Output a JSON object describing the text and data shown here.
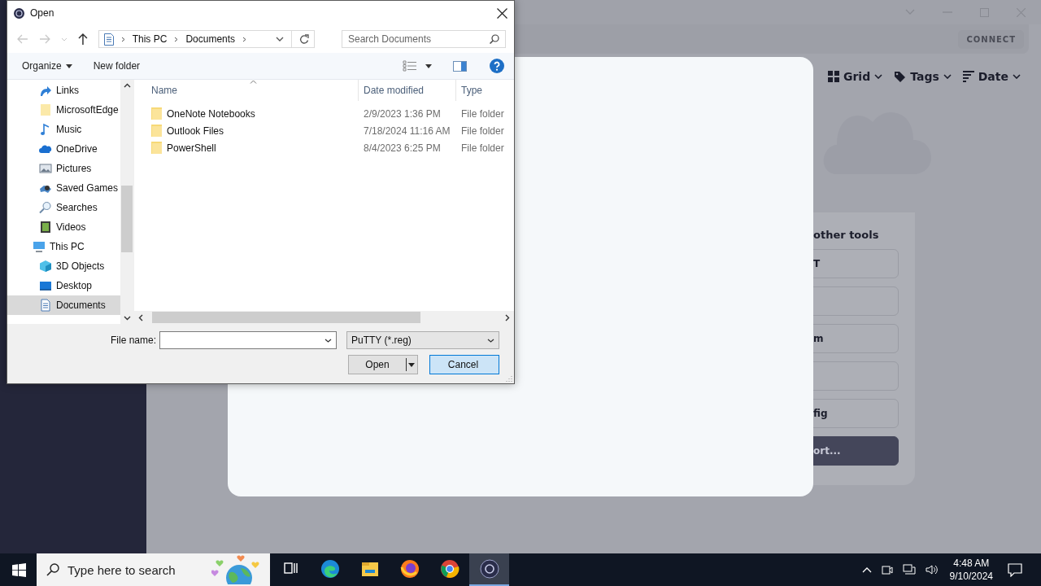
{
  "app": {
    "connect": "CONNECT",
    "view_options": [
      {
        "label": "Grid",
        "kind": "grid"
      },
      {
        "label": "Tags",
        "kind": "tag"
      },
      {
        "label": "Date",
        "kind": "sort"
      }
    ],
    "tools_heading": "other tools",
    "tool_buttons": [
      {
        "label": "T",
        "primary": false
      },
      {
        "primary": false
      },
      {
        "label": "m",
        "primary": false
      },
      {
        "primary": false
      },
      {
        "label": "fig",
        "primary": false
      },
      {
        "label": "ort...",
        "primary": true
      }
    ]
  },
  "dialog": {
    "title": "Open",
    "breadcrumb": [
      "This PC",
      "Documents"
    ],
    "search": {
      "placeholder": "Search Documents"
    },
    "commands": [
      {
        "label": "Organize",
        "dropdown": true
      },
      {
        "label": "New folder",
        "dropdown": false
      }
    ],
    "nav": [
      {
        "label": "Links",
        "kind": "link",
        "selected": false
      },
      {
        "label": "MicrosoftEdge",
        "kind": "folder",
        "selected": false
      },
      {
        "label": "Music",
        "kind": "music",
        "selected": false
      },
      {
        "label": "OneDrive",
        "kind": "cloud",
        "selected": false
      },
      {
        "label": "Pictures",
        "kind": "pictures",
        "selected": false
      },
      {
        "label": "Saved Games",
        "kind": "games",
        "selected": false
      },
      {
        "label": "Searches",
        "kind": "search",
        "selected": false
      },
      {
        "label": "Videos",
        "kind": "video",
        "selected": false
      },
      {
        "label": "This PC",
        "kind": "computer",
        "selected": false,
        "children": [
          {
            "label": "3D Objects",
            "kind": "cube",
            "selected": false
          },
          {
            "label": "Desktop",
            "kind": "desktop",
            "selected": false
          },
          {
            "label": "Documents",
            "kind": "document",
            "selected": true
          }
        ]
      }
    ],
    "columns": [
      "Name",
      "Date modified",
      "Type"
    ],
    "rows": [
      {
        "name": "OneNote Notebooks",
        "date": "2/9/2023 1:36 PM",
        "type": "File folder"
      },
      {
        "name": "Outlook Files",
        "date": "7/18/2024 11:16 AM",
        "type": "File folder"
      },
      {
        "name": "PowerShell",
        "date": "8/4/2023 6:25 PM",
        "type": "File folder"
      }
    ],
    "file_name_label": "File name:",
    "filter": "PuTTY (*.reg)",
    "buttons": [
      {
        "label": "Open",
        "kind": "split",
        "focused": false
      },
      {
        "label": "Cancel",
        "kind": "plain",
        "focused": true
      }
    ]
  },
  "taskbar": {
    "search_placeholder": "Type here to search",
    "apps": [
      {
        "kind": "taskview",
        "active": false
      },
      {
        "kind": "edge",
        "active": false
      },
      {
        "kind": "explorer",
        "active": false
      },
      {
        "kind": "firefox",
        "active": false
      },
      {
        "kind": "chrome",
        "active": false
      },
      {
        "kind": "app",
        "active": true
      }
    ],
    "time": "4:48 AM",
    "date": "9/10/2024"
  }
}
